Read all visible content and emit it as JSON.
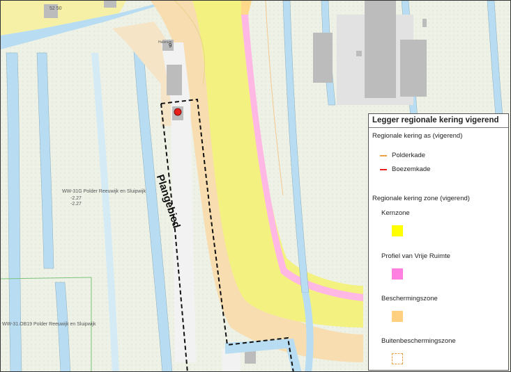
{
  "map": {
    "labels": {
      "house_numbers": "52  50",
      "building_label": "Huisnum",
      "building_number": "9",
      "plan_area": "Plangebied",
      "ww_main": "WW-31G  Polder Reeuwijk en Sluipwijk",
      "ww_level_1": "-2.27",
      "ww_level_2": "-2.27",
      "ww_lower": "WW-31.OB19  Polder Reeuwijk en Sluipwijk"
    }
  },
  "legend": {
    "title": "Legger regionale kering vigerend",
    "section_axis": "Regionale kering as (vigerend)",
    "axis_items": [
      {
        "label": "Polderkade",
        "color": "#f0a040"
      },
      {
        "label": "Boezemkade",
        "color": "#e8201c"
      }
    ],
    "section_zone": "Regionale kering zone (vigerend)",
    "zone_items": [
      {
        "label": "Kernzone",
        "color": "#ffff00",
        "style": "solid"
      },
      {
        "label": "Profiel van Vrije Ruimte",
        "color": "#ff80e0",
        "style": "solid"
      },
      {
        "label": "Beschermingszone",
        "color": "#ffd080",
        "style": "solid"
      },
      {
        "label": "Buitenbeschermingszone",
        "color": "#f0a040",
        "style": "dashed"
      }
    ]
  }
}
